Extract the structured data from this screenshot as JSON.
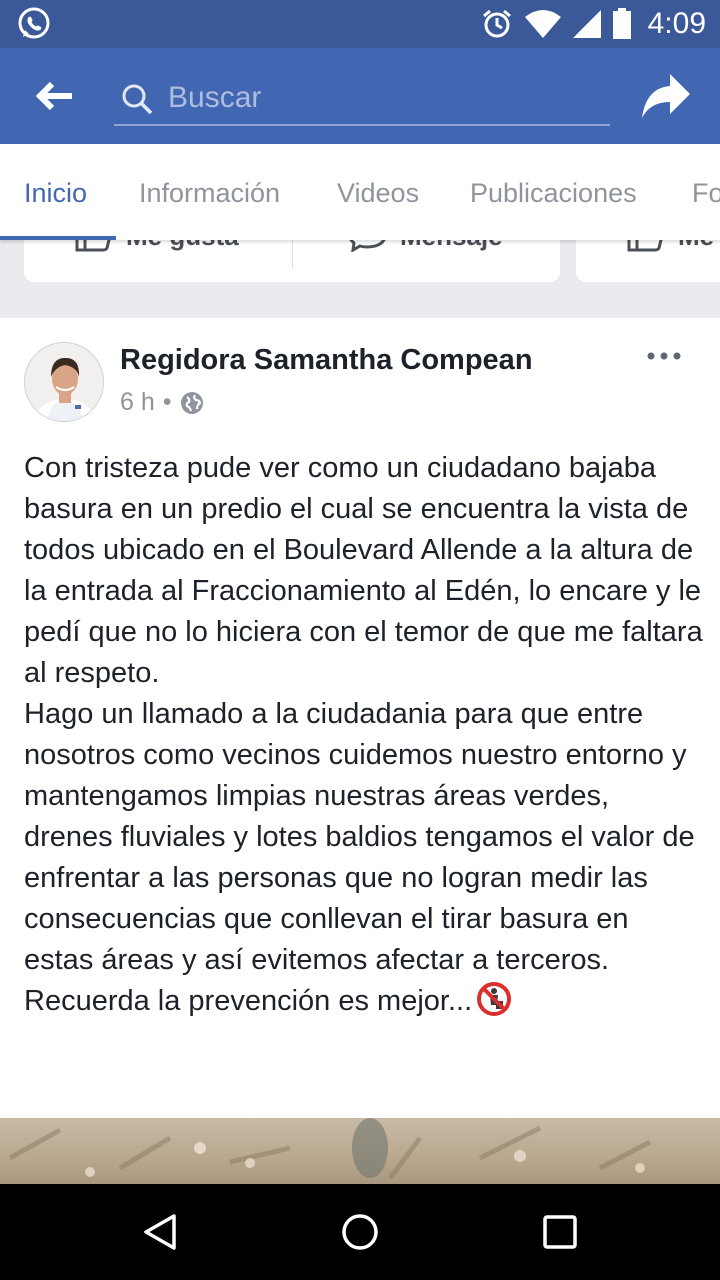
{
  "status_bar": {
    "time": "4:09",
    "icons": [
      "whatsapp-icon",
      "alarm-icon",
      "wifi-icon",
      "signal-icon",
      "battery-icon"
    ]
  },
  "app_bar": {
    "search_placeholder": "Buscar",
    "icons": [
      "back-arrow-icon",
      "search-icon",
      "share-icon"
    ]
  },
  "tabs": [
    {
      "label": "Inicio",
      "active": true
    },
    {
      "label": "Información",
      "active": false
    },
    {
      "label": "Videos",
      "active": false
    },
    {
      "label": "Publicaciones",
      "active": false
    },
    {
      "label": "Fo",
      "active": false
    }
  ],
  "actions": {
    "like_label": "Me gusta",
    "message_label": "Mensaje",
    "third_label": "Me"
  },
  "post": {
    "author": "Regidora Samantha Compean",
    "time": "6 h",
    "separator": "•",
    "body": "Con tristeza pude ver como un ciudadano bajaba basura en un predio el cual se encuentra la vista de todos ubicado en el Boulevard Allende a la altura de la entrada al Fraccionamiento al Edén, lo encare y le pedí que no lo hiciera con el temor de que me faltara al respeto.\nHago un llamado a la ciudadania para que entre nosotros como vecinos cuidemos nuestro entorno y mantengamos limpias nuestras áreas verdes, drenes fluviales y lotes baldios tengamos el valor de enfrentar a las personas que no logran  medir las consecuencias que conllevan el tirar basura en estas áreas y así evitemos afectar a terceros.\nRecuerda la prevención es mejor..."
  },
  "colors": {
    "status_bar": "#3b5998",
    "app_bar": "#4267b2",
    "accent": "#4267b2",
    "background": "#e9ebee"
  }
}
